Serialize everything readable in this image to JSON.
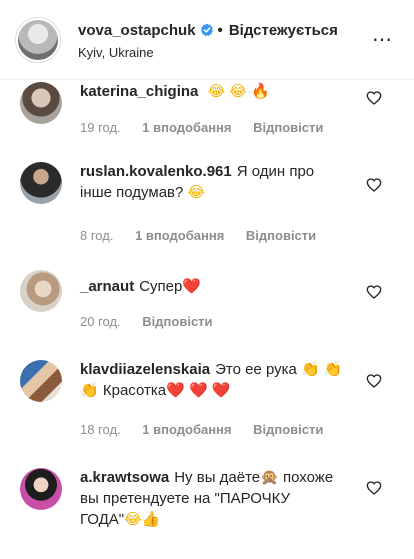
{
  "header": {
    "username": "vova_ostapchuk",
    "separator": "•",
    "follow_label": "Відстежується",
    "location": "Kyiv, Ukraine",
    "more": "⋯"
  },
  "comments": [
    {
      "username": "katerina_chigina",
      "text": "",
      "emojis": [
        "😂",
        "😂",
        "🔥"
      ],
      "time": "19 год.",
      "likes": "1 вподобання",
      "reply": "Відповісти"
    },
    {
      "username": "ruslan.kovalenko.961",
      "text": "Я один про інше подумав?",
      "emojis": [
        "😂"
      ],
      "time": "8 год.",
      "likes": "1 вподобання",
      "reply": "Відповісти"
    },
    {
      "username": "_arnaut",
      "text": "Супер",
      "emojis": [
        "❤️"
      ],
      "time": "20 год.",
      "likes": "",
      "reply": "Відповісти"
    },
    {
      "username": "klavdiiazelenskaia",
      "text": "Это ее рука",
      "emojis": [
        "👏"
      ],
      "text2": "Красотка",
      "emojis_line2_prefix": [
        "👏",
        "👏"
      ],
      "emojis2": [
        "❤️",
        "❤️",
        "❤️"
      ],
      "time": "18 год.",
      "likes": "1 вподобання",
      "reply": "Відповісти"
    },
    {
      "username": "a.krawtsowa",
      "text": "Ну вы даёте",
      "emojis": [
        "🙊"
      ],
      "text2": "похоже вы претендуете на",
      "text3": "\"ПАРОЧКУ ГОДА\"",
      "emojis3": [
        "😂",
        "👍"
      ],
      "time": "",
      "likes": "",
      "reply": ""
    }
  ]
}
